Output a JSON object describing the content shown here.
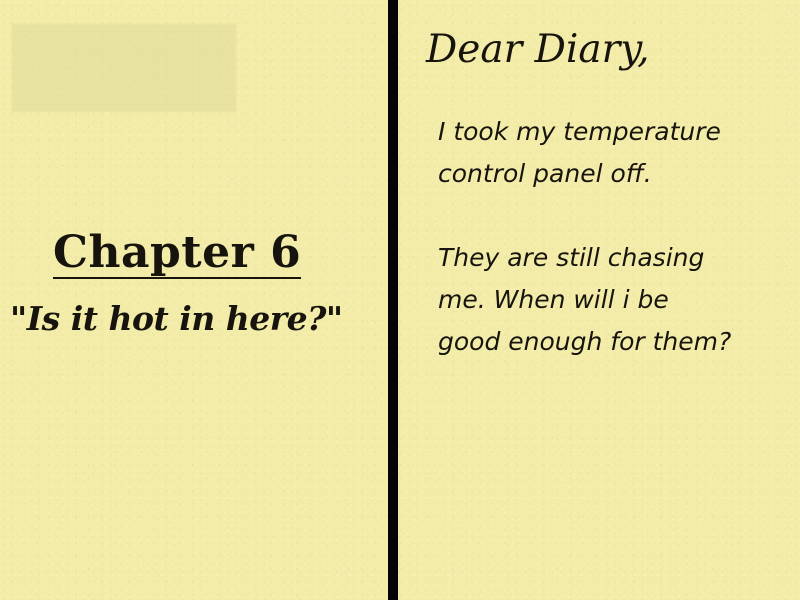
{
  "page": {
    "left": {
      "chapter_title": "Chapter 6",
      "chapter_subtitle": "\"Is it hot in here?\""
    },
    "right": {
      "heading": "Dear Diary,",
      "paragraphs": [
        "I took my temperature\ncontrol panel off.",
        "They are still chasing\nme. When will i  be\ngood enough for them?"
      ]
    }
  },
  "colors": {
    "paper": "#f3eca8",
    "ink": "#17140d",
    "divider": "#050505"
  }
}
